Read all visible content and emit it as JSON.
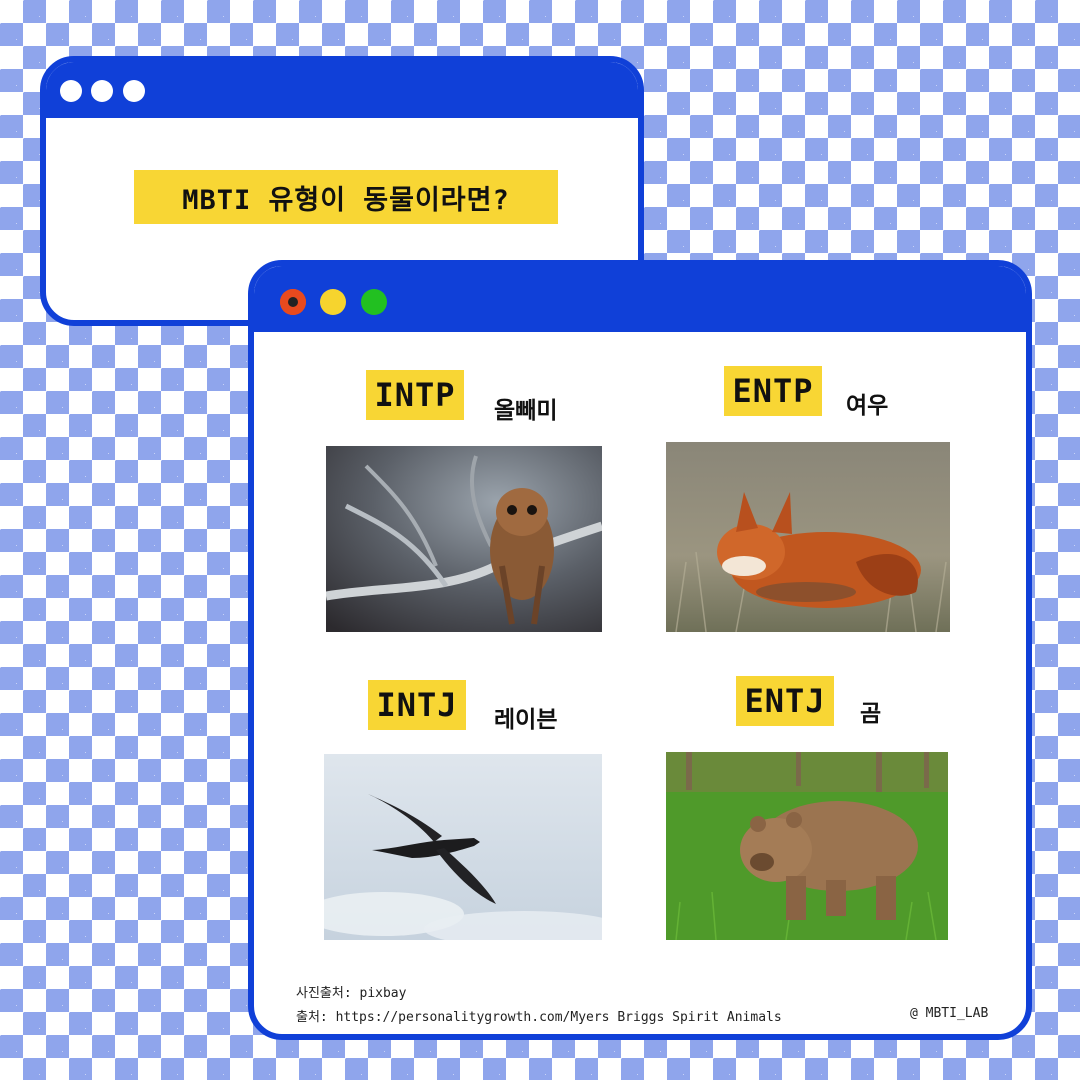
{
  "header_window": {
    "dots": [
      "window-dot",
      "window-dot",
      "window-dot"
    ],
    "headline": "MBTI 유형이 동물이라면?"
  },
  "main_window": {
    "traffic_lights": {
      "red": "#e84a1e",
      "yellow": "#f6d42e",
      "green": "#22c021"
    },
    "cards": [
      {
        "type": "INTP",
        "animal": "올빼미",
        "image": "owl-photo"
      },
      {
        "type": "ENTP",
        "animal": "여우",
        "image": "fox-photo"
      },
      {
        "type": "INTJ",
        "animal": "레이븐",
        "image": "raven-photo"
      },
      {
        "type": "ENTJ",
        "animal": "곰",
        "image": "bear-photo"
      }
    ],
    "credits": {
      "photo_source": "사진출처: pixbay",
      "source": "출처: https://personalitygrowth.com/Myers Briggs Spirit Animals",
      "handle": "@ MBTI_LAB"
    }
  },
  "colors": {
    "accent_blue": "#1040d8",
    "tag_yellow": "#f8d634",
    "checker_blue": "#8fa5ec"
  }
}
